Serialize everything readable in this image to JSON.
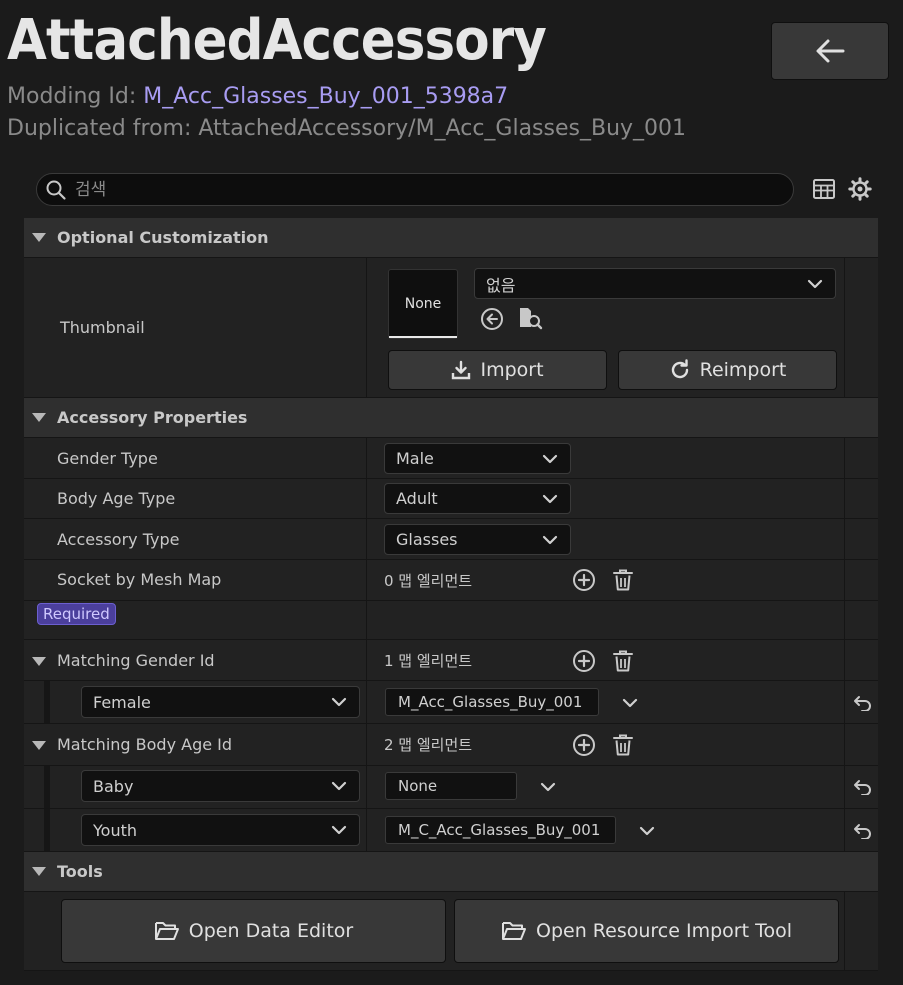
{
  "header": {
    "title": "AttachedAccessory",
    "modding_id_label": "Modding Id:",
    "modding_id_value": "M_Acc_Glasses_Buy_001_5398a7",
    "duplicated_label": "Duplicated from:",
    "duplicated_value": "AttachedAccessory/M_Acc_Glasses_Buy_001"
  },
  "search": {
    "placeholder": "검색",
    "value": ""
  },
  "sections": {
    "optional": "Optional Customization",
    "accessory": "Accessory Properties",
    "tools": "Tools"
  },
  "thumbnail": {
    "label": "Thumbnail",
    "preview_text": "None",
    "asset_combo": "없음",
    "import_label": "Import",
    "reimport_label": "Reimport"
  },
  "properties": {
    "gender_type": {
      "label": "Gender Type",
      "value": "Male"
    },
    "body_age_type": {
      "label": "Body Age Type",
      "value": "Adult"
    },
    "accessory_type": {
      "label": "Accessory Type",
      "value": "Glasses"
    },
    "socket_map": {
      "label": "Socket by Mesh Map",
      "count": "0 맵 엘리먼트"
    },
    "required_badge": "Required",
    "matching_gender": {
      "label": "Matching Gender Id",
      "count": "1 맵 엘리먼트",
      "entries": [
        {
          "key": "Female",
          "value": "M_Acc_Glasses_Buy_001"
        }
      ]
    },
    "matching_body_age": {
      "label": "Matching Body Age Id",
      "count": "2 맵 엘리먼트",
      "entries": [
        {
          "key": "Baby",
          "value": "None"
        },
        {
          "key": "Youth",
          "value": "M_C_Acc_Glasses_Buy_001"
        }
      ]
    }
  },
  "tools": {
    "open_data_editor": "Open Data Editor",
    "open_resource_import": "Open Resource Import Tool"
  }
}
